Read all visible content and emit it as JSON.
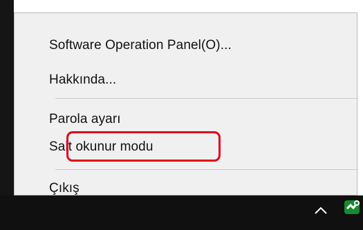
{
  "menu": {
    "items": [
      {
        "label": "Software Operation Panel(O)..."
      },
      {
        "label": "Hakkında..."
      },
      {
        "label": "Parola ayarı"
      },
      {
        "label": "Salt okunur modu"
      },
      {
        "label": "Çıkış"
      }
    ]
  },
  "tray": {
    "icons": [
      "caret-up-icon",
      "scanner-app-icon"
    ]
  },
  "colors": {
    "highlight": "#e1001a",
    "menu_background": "#f0f0f0",
    "taskbar": "#101010"
  }
}
